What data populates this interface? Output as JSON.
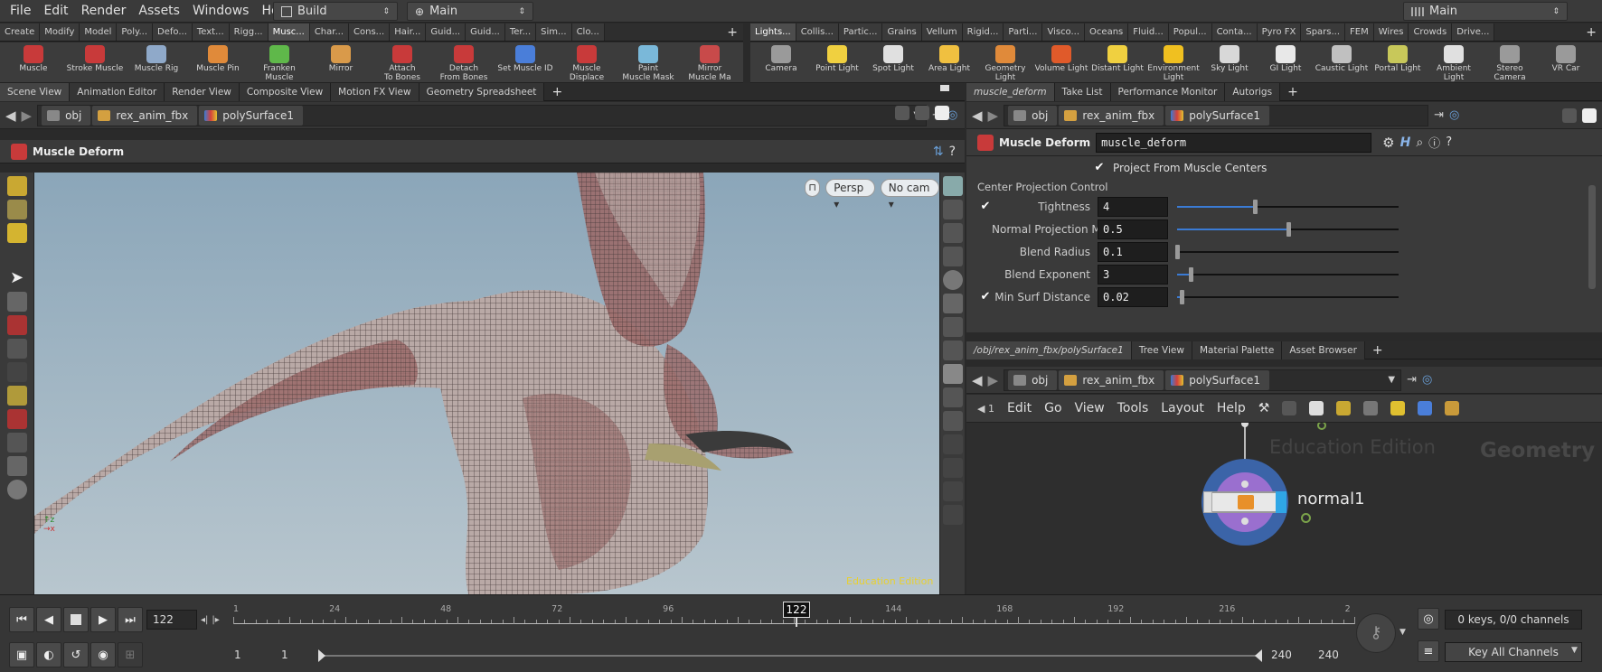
{
  "menubar": {
    "items": [
      "File",
      "Edit",
      "Render",
      "Assets",
      "Windows",
      "Help"
    ],
    "desktop_label": "Build",
    "context_label": "Main",
    "right_desktop": "Main"
  },
  "shelf_left": {
    "tabs": [
      "Create",
      "Modify",
      "Model",
      "Poly...",
      "Defo...",
      "Text...",
      "Rigg...",
      "Musc...",
      "Char...",
      "Cons...",
      "Hair...",
      "Guid...",
      "Guid...",
      "Ter...",
      "Sim...",
      "Clo..."
    ],
    "active_tab": 7,
    "tools": [
      {
        "label": "Muscle",
        "color": "#c83a3a"
      },
      {
        "label": "Stroke Muscle",
        "color": "#c83a3a"
      },
      {
        "label": "Muscle Rig",
        "color": "#8fa9c9"
      },
      {
        "label": "Muscle Pin",
        "color": "#e08a3a"
      },
      {
        "label": "Franken\nMuscle",
        "color": "#5fb84a"
      },
      {
        "label": "Mirror",
        "color": "#d99a4a"
      },
      {
        "label": "Attach\nTo Bones",
        "color": "#c83a3a"
      },
      {
        "label": "Detach\nFrom Bones",
        "color": "#c83a3a"
      },
      {
        "label": "Set Muscle ID",
        "color": "#4a7ed9"
      },
      {
        "label": "Muscle\nDisplace",
        "color": "#c83a3a"
      },
      {
        "label": "Paint\nMuscle Mask",
        "color": "#7ab8d9"
      },
      {
        "label": "Mirror\nMuscle Ma",
        "color": "#c84a4a"
      }
    ]
  },
  "shelf_right": {
    "tabs": [
      "Lights...",
      "Collis...",
      "Partic...",
      "Grains",
      "Vellum",
      "Rigid...",
      "Parti...",
      "Visco...",
      "Oceans",
      "Fluid...",
      "Popul...",
      "Conta...",
      "Pyro FX",
      "Spars...",
      "FEM",
      "Wires",
      "Crowds",
      "Drive..."
    ],
    "active_tab": 0,
    "tools": [
      {
        "label": "Camera",
        "color": "#9a9a9a"
      },
      {
        "label": "Point Light",
        "color": "#f0d040"
      },
      {
        "label": "Spot Light",
        "color": "#e0e0e0"
      },
      {
        "label": "Area Light",
        "color": "#f0c040"
      },
      {
        "label": "Geometry\nLight",
        "color": "#e08a3a"
      },
      {
        "label": "Volume Light",
        "color": "#e05a2a"
      },
      {
        "label": "Distant Light",
        "color": "#f0d040"
      },
      {
        "label": "Environment\nLight",
        "color": "#f0c020"
      },
      {
        "label": "Sky Light",
        "color": "#d8d8d8"
      },
      {
        "label": "GI Light",
        "color": "#e8e8e8"
      },
      {
        "label": "Caustic Light",
        "color": "#c0c0c0"
      },
      {
        "label": "Portal Light",
        "color": "#c8c85a"
      },
      {
        "label": "Ambient Light",
        "color": "#e0e0e0"
      },
      {
        "label": "Stereo\nCamera",
        "color": "#9a9a9a"
      },
      {
        "label": "VR Car",
        "color": "#9a9a9a"
      }
    ]
  },
  "left_pane": {
    "tabs": [
      "Scene View",
      "Animation Editor",
      "Render View",
      "Composite View",
      "Motion FX View",
      "Geometry Spreadsheet"
    ],
    "path": [
      "obj",
      "rex_anim_fbx",
      "polySurface1"
    ],
    "op_title": "Muscle Deform",
    "persp_label": "Persp",
    "cam_label": "No cam",
    "watermark": "Education Edition"
  },
  "param_pane": {
    "tabs": [
      "muscle_deform",
      "Take List",
      "Performance Monitor",
      "Autorigs"
    ],
    "path": [
      "obj",
      "rex_anim_fbx",
      "polySurface1"
    ],
    "op_type": "Muscle Deform",
    "op_name": "muscle_deform",
    "project_label": "Project From Muscle Centers",
    "section_label": "Center Projection Control",
    "params": [
      {
        "label": "Tightness",
        "value": "4",
        "fraction": 0.35,
        "checkbox": true
      },
      {
        "label": "Normal Projection Mi...",
        "value": "0.5",
        "fraction": 0.5,
        "checkbox": false
      },
      {
        "label": "Blend Radius",
        "value": "0.1",
        "fraction": 0.0,
        "checkbox": false
      },
      {
        "label": "Blend Exponent",
        "value": "3",
        "fraction": 0.06,
        "checkbox": false
      },
      {
        "label": "Min Surf Distance",
        "value": "0.02",
        "fraction": 0.02,
        "checkbox": true
      }
    ]
  },
  "network_pane": {
    "tabs": [
      "/obj/rex_anim_fbx/polySurface1",
      "Tree View",
      "Material Palette",
      "Asset Browser"
    ],
    "path": [
      "obj",
      "rex_anim_fbx",
      "polySurface1"
    ],
    "menu": [
      "Edit",
      "Go",
      "View",
      "Tools",
      "Layout",
      "Help"
    ],
    "watermark": "Education Edition",
    "context_label": "Geometry",
    "node_name": "normal1"
  },
  "timeline": {
    "current_frame": "122",
    "ticks": [
      "1",
      "24",
      "48",
      "72",
      "96",
      "144",
      "168",
      "192",
      "216",
      "2"
    ],
    "start_frame": "1",
    "range_start": "1",
    "range_end": "240",
    "end_frame": "240",
    "keys_label": "0 keys, 0/0 channels",
    "key_all_label": "Key All Channels"
  }
}
